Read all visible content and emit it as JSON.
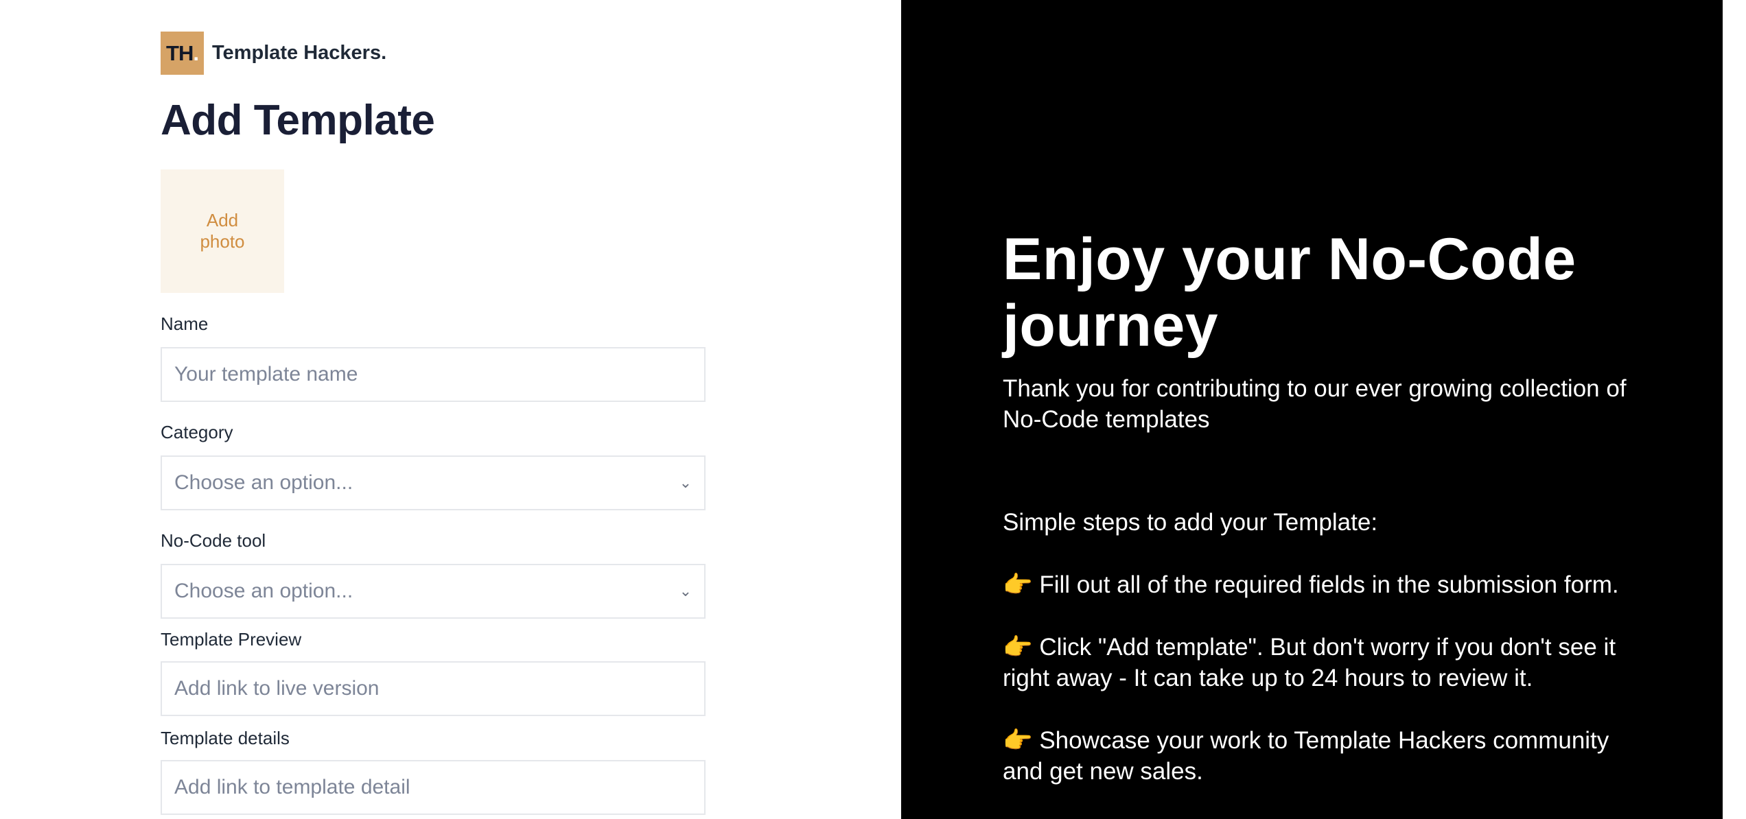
{
  "brand": {
    "logo_text": "TH",
    "logo_dot": ".",
    "name": "Template Hackers."
  },
  "form": {
    "title": "Add Template",
    "photo_label": "Add photo",
    "name": {
      "label": "Name",
      "placeholder": "Your template name"
    },
    "category": {
      "label": "Category",
      "value": "Choose an option..."
    },
    "tool": {
      "label": "No-Code tool",
      "value": "Choose an option..."
    },
    "preview": {
      "label": "Template Preview",
      "placeholder": "Add link to live version"
    },
    "details": {
      "label": "Template details",
      "placeholder": "Add link to template detail"
    }
  },
  "hero": {
    "title": "Enjoy your No-Code journey",
    "subtitle": "Thank you for contributing to our ever growing collection of No-Code templates",
    "steps_heading": "Simple steps to add your Template:",
    "steps": [
      "Fill out all of the required fields in the submission form.",
      "Click \"Add template\". But don't worry if you don't see it right away - It can take up to 24 hours to review it.",
      "Showcase your work to Template Hackers community and get new sales."
    ],
    "step_icon": "👉"
  },
  "colors": {
    "accent": "#d6a366",
    "photo_bg": "#faf4ea",
    "photo_text": "#d08d40",
    "panel": "#000000"
  }
}
